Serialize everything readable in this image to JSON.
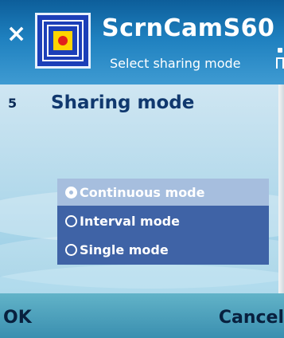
{
  "titlebar": {
    "app_title": "ScrnCamS60",
    "subtitle": "Select sharing mode",
    "close_icon": "close-icon"
  },
  "content": {
    "page_number": "5",
    "heading": "Sharing mode"
  },
  "options": [
    {
      "label": "Continuous mode",
      "selected": true
    },
    {
      "label": "Interval mode",
      "selected": false
    },
    {
      "label": "Single mode",
      "selected": false
    }
  ],
  "softkeys": {
    "left": "OK",
    "right": "Cancel"
  },
  "colors": {
    "title_bar": "#1e80bf",
    "selected_option": "#a6bede",
    "option_list": "#3f63a6",
    "heading_text": "#10386e"
  }
}
